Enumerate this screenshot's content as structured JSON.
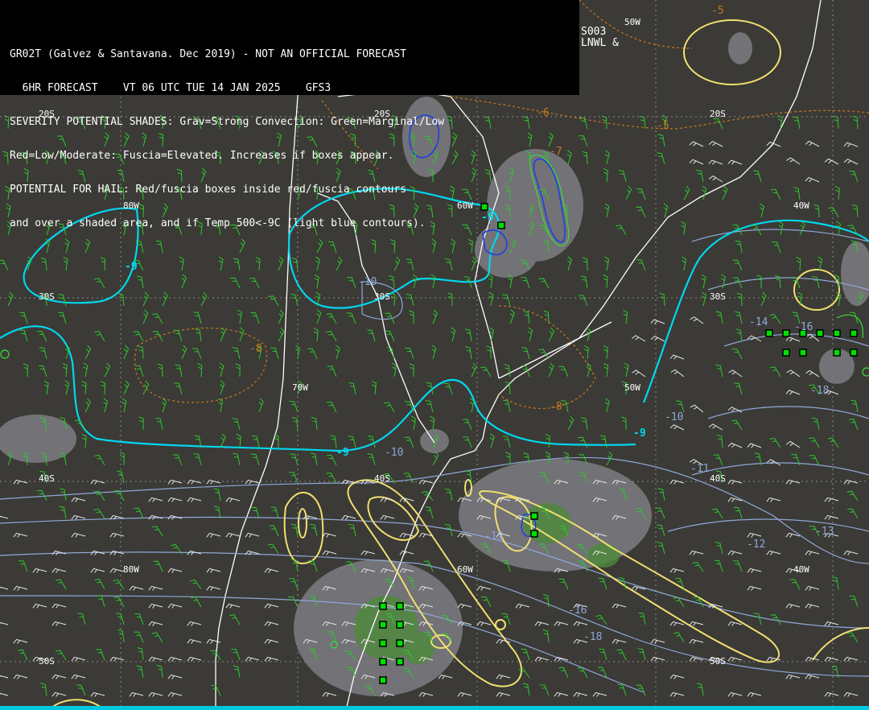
{
  "header": {
    "line1": "GR02T (Galvez & Santavana. Dec 2019) - NOT AN OFFICIAL FORECAST",
    "line2": "  6HR FORECAST    VT 06 UTC TUE 14 JAN 2025    GFS3",
    "line3": "SEVERITY POTENTIAL SHADES: Grav=Strong Convection: Green=Marginal/Low",
    "line4": "Red=Low/Moderate: Fuscia=Elevated. Increases if boxes appear.",
    "line5": "POTENTIAL FOR HAIL: Red/fuscia boxes inside red/fuscia contours",
    "line6": "and over a shaded area, and if Temp 500<-9C (light blue contours)."
  },
  "corner": {
    "line1": "S003",
    "line2": "LNWL &"
  },
  "grid_labels": {
    "lat_20s": "20S",
    "lat_30s": "30S",
    "lat_40s": "40S",
    "lat_50s": "50S",
    "lon_80w": "80W",
    "lon_70w": "70W",
    "lon_60w": "60W",
    "lon_50w": "50W",
    "lon_40w": "40W"
  },
  "contour_labels": {
    "minus5": "-5",
    "minus6": "-6",
    "minus7": "-7",
    "minus8": "-8",
    "minus9": "-9",
    "minus10": "-10",
    "minus11": "-11",
    "minus12": "-12",
    "minus13": "-13",
    "minus14": "-14",
    "minus16": "-16",
    "minus18": "-18"
  },
  "colors": {
    "background": "#3b3a36",
    "coastline": "#ffffff",
    "temp_minus9_contour": "#00d8f0",
    "cold_contours": "#8fa8d8",
    "warm_contours": "#c8781e",
    "severity_gray": "#7d7c82",
    "severity_green": "#4e8a3a",
    "hail_contour_yellow": "#f0e070",
    "blue_contour": "#2040e0",
    "wind_barbs": "#2ec82e",
    "grid": "#9a9a9a"
  }
}
